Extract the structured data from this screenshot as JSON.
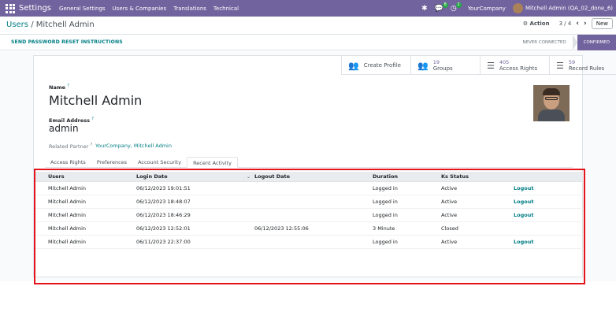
{
  "navbar": {
    "app_title": "Settings",
    "menu": [
      "General Settings",
      "Users & Companies",
      "Translations",
      "Technical"
    ],
    "chat_count": "8",
    "activity_count": "2",
    "company": "YourCompany",
    "user": "Mitchell Admin (QA_02_done_6)"
  },
  "control_panel": {
    "breadcrumb_parent": "Users",
    "breadcrumb_sep": " / ",
    "breadcrumb_current": "Mitchell Admin",
    "action_label": "⚙ Action",
    "pager": "3 / 4",
    "new_label": "New"
  },
  "statusbar": {
    "button": "SEND PASSWORD RESET INSTRUCTIONS",
    "stages": [
      "NEVER CONNECTED",
      "CONFIRMED"
    ],
    "active_stage": "CONFIRMED"
  },
  "smart_buttons": [
    {
      "icon": "users-icon",
      "value": "",
      "label": "Create Profile"
    },
    {
      "icon": "users-icon",
      "value": "19",
      "label": "Groups"
    },
    {
      "icon": "list-icon",
      "value": "405",
      "label": "Access Rights"
    },
    {
      "icon": "list-icon",
      "value": "59",
      "label": "Record Rules"
    }
  ],
  "form": {
    "name_label": "Name",
    "name_value": "Mitchell Admin",
    "email_label": "Email Address",
    "email_value": "admin",
    "partner_label": "Related Partner",
    "partner_value": "YourCompany, Mitchell Admin",
    "help_mark": "?"
  },
  "tabs": [
    "Access Rights",
    "Preferences",
    "Account Security",
    "Recent Activity"
  ],
  "active_tab": "Recent Activity",
  "table": {
    "columns": [
      "Users",
      "Login Date",
      "Logout Date",
      "Duration",
      "Ks Status"
    ],
    "rows": [
      {
        "user": "Mitchell Admin",
        "login": "06/12/2023 19:01:51",
        "logout": "",
        "duration": "Logged in",
        "status": "Active",
        "action": "Logout"
      },
      {
        "user": "Mitchell Admin",
        "login": "06/12/2023 18:48:07",
        "logout": "",
        "duration": "Logged in",
        "status": "Active",
        "action": "Logout"
      },
      {
        "user": "Mitchell Admin",
        "login": "06/12/2023 18:46:29",
        "logout": "",
        "duration": "Logged in",
        "status": "Active",
        "action": "Logout"
      },
      {
        "user": "Mitchell Admin",
        "login": "06/12/2023 12:52:01",
        "logout": "06/12/2023 12:55:06",
        "duration": "3 Minute",
        "status": "Closed",
        "action": ""
      },
      {
        "user": "Mitchell Admin",
        "login": "06/11/2023 22:37:00",
        "logout": "",
        "duration": "Logged in",
        "status": "Active",
        "action": "Logout"
      }
    ]
  },
  "colors": {
    "navbar": "#71639e",
    "link": "#017e84",
    "highlight": "#e3141b"
  }
}
